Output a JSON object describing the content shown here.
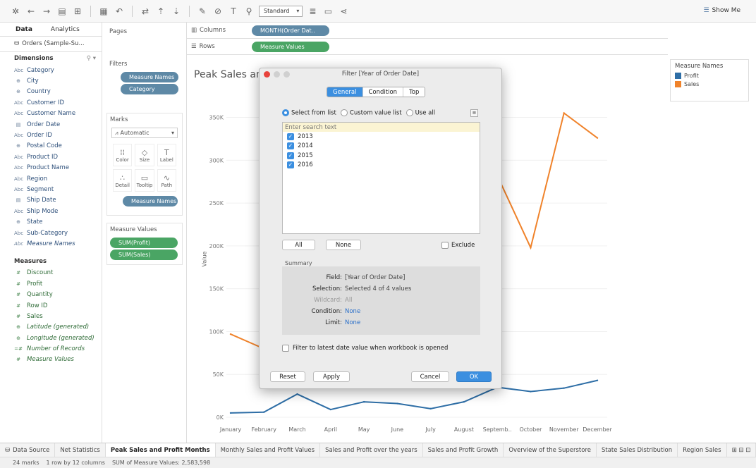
{
  "toolbar": {
    "format_select": "Standard",
    "show_me": "Show Me"
  },
  "datapane": {
    "tabs": [
      "Data",
      "Analytics"
    ],
    "datasource": "Orders (Sample-Su...",
    "dimensions_header": "Dimensions",
    "dimensions": [
      {
        "type": "Abc",
        "label": "Category"
      },
      {
        "type": "⊕",
        "label": "City"
      },
      {
        "type": "⊕",
        "label": "Country"
      },
      {
        "type": "Abc",
        "label": "Customer ID"
      },
      {
        "type": "Abc",
        "label": "Customer Name"
      },
      {
        "type": "▤",
        "label": "Order Date"
      },
      {
        "type": "Abc",
        "label": "Order ID"
      },
      {
        "type": "⊕",
        "label": "Postal Code"
      },
      {
        "type": "Abc",
        "label": "Product ID"
      },
      {
        "type": "Abc",
        "label": "Product Name"
      },
      {
        "type": "Abc",
        "label": "Region"
      },
      {
        "type": "Abc",
        "label": "Segment"
      },
      {
        "type": "▤",
        "label": "Ship Date"
      },
      {
        "type": "Abc",
        "label": "Ship Mode"
      },
      {
        "type": "⊕",
        "label": "State"
      },
      {
        "type": "Abc",
        "label": "Sub-Category"
      },
      {
        "type": "Abc",
        "label": "Measure Names"
      }
    ],
    "measures_header": "Measures",
    "measures": [
      {
        "type": "#",
        "label": "Discount"
      },
      {
        "type": "#",
        "label": "Profit"
      },
      {
        "type": "#",
        "label": "Quantity"
      },
      {
        "type": "#",
        "label": "Row ID"
      },
      {
        "type": "#",
        "label": "Sales"
      },
      {
        "type": "⊕",
        "label": "Latitude (generated)"
      },
      {
        "type": "⊕",
        "label": "Longitude (generated)"
      },
      {
        "type": "=#",
        "label": "Number of Records"
      },
      {
        "type": "#",
        "label": "Measure Values"
      }
    ]
  },
  "cards": {
    "pages": "Pages",
    "filters": "Filters",
    "filter_pills": [
      "Measure Names",
      "Category"
    ],
    "marks": "Marks",
    "marks_type": "Automatic",
    "mark_buttons": [
      {
        "icon": "⁞⁞",
        "label": "Color"
      },
      {
        "icon": "◇",
        "label": "Size"
      },
      {
        "icon": "T",
        "label": "Label"
      },
      {
        "icon": "∴",
        "label": "Detail"
      },
      {
        "icon": "▭",
        "label": "Tooltip"
      },
      {
        "icon": "∿",
        "label": "Path"
      }
    ],
    "marks_pill": "Measure Names",
    "measure_values": "Measure Values",
    "measure_pills": [
      "SUM(Profit)",
      "SUM(Sales)"
    ]
  },
  "shelves": {
    "columns_label": "Columns",
    "columns_pill": "MONTH(Order Dat..",
    "rows_label": "Rows",
    "rows_pill": "Measure Values"
  },
  "view": {
    "sheet_title": "Peak Sales an",
    "y_axis_label": "Value"
  },
  "legend": {
    "title": "Measure Names",
    "items": [
      {
        "label": "Profit",
        "color": "#2e6ea6"
      },
      {
        "label": "Sales",
        "color": "#f0832b"
      }
    ]
  },
  "chart_data": {
    "type": "line",
    "categories": [
      "January",
      "February",
      "March",
      "April",
      "May",
      "June",
      "July",
      "August",
      "Septemb..",
      "October",
      "November",
      "December"
    ],
    "series": [
      {
        "name": "Profit",
        "color": "#2e6ea6",
        "values": [
          5,
          6,
          27,
          9,
          18,
          16,
          10,
          18,
          35,
          30,
          34,
          43
        ]
      },
      {
        "name": "Sales",
        "color": "#f0832b",
        "values": [
          97,
          80,
          null,
          null,
          null,
          null,
          null,
          null,
          282,
          198,
          355,
          326
        ]
      }
    ],
    "y_ticks": [
      "0K",
      "50K",
      "100K",
      "150K",
      "200K",
      "250K",
      "300K",
      "350K"
    ],
    "ylim": [
      0,
      385
    ]
  },
  "dialog": {
    "title": "Filter [Year of Order Date]",
    "tabs": [
      "General",
      "Condition",
      "Top"
    ],
    "radio_options": [
      "Select from list",
      "Custom value list",
      "Use all"
    ],
    "search_placeholder": "Enter search text",
    "years": [
      "2013",
      "2014",
      "2015",
      "2016"
    ],
    "all_button": "All",
    "none_button": "None",
    "exclude": "Exclude",
    "summary_label": "Summary",
    "summary": [
      {
        "key": "Field:",
        "value": "[Year of Order Date]"
      },
      {
        "key": "Selection:",
        "value": "Selected 4 of 4 values"
      },
      {
        "key": "Wildcard:",
        "value": "All"
      },
      {
        "key": "Condition:",
        "value": "None"
      },
      {
        "key": "Limit:",
        "value": "None"
      }
    ],
    "latest_date": "Filter to latest date value when workbook is opened",
    "reset": "Reset",
    "apply": "Apply",
    "cancel": "Cancel",
    "ok": "OK"
  },
  "sheet_tabs": {
    "data_source": "Data Source",
    "tabs": [
      "Net Statistics",
      "Peak Sales and Profit Months",
      "Monthly Sales and Profit Values",
      "Sales and Profit over the years",
      "Sales and Profit Growth",
      "Overview of the Superstore",
      "State Sales Distribution",
      "Region Sales"
    ]
  },
  "status": {
    "marks": "24 marks",
    "rows": "1 row by 12 columns",
    "sum": "SUM of Measure Values: 2,583,598"
  }
}
